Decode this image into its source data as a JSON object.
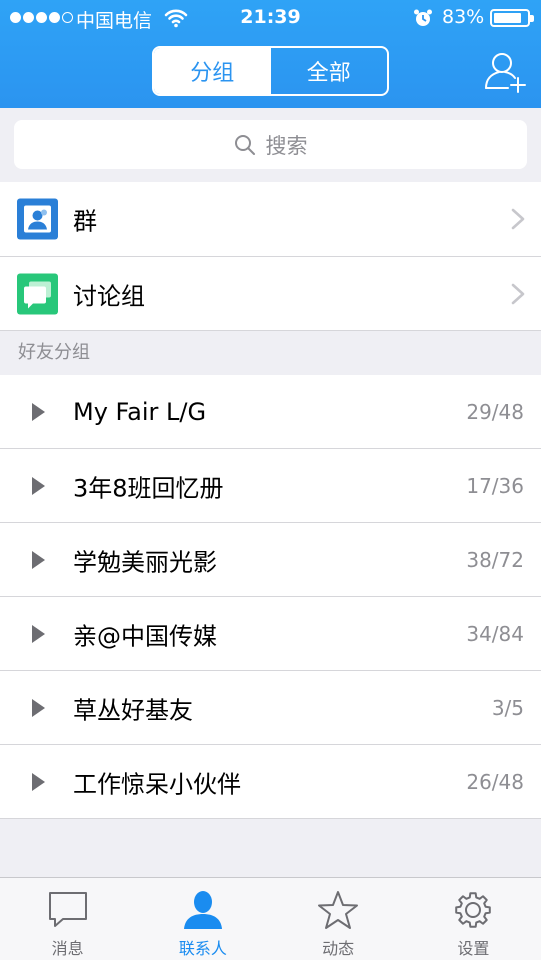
{
  "status_bar": {
    "carrier": "中国电信",
    "time": "21:39",
    "battery": "83%",
    "battery_level": 0.83,
    "signal_bars": 4,
    "signal_total": 5
  },
  "header": {
    "segments": [
      {
        "label": "分组",
        "active": true
      },
      {
        "label": "全部",
        "active": false
      }
    ],
    "add_friend_icon": "add-contact-icon"
  },
  "search": {
    "placeholder": "搜索"
  },
  "quick_entries": [
    {
      "label": "群",
      "icon": "group-icon",
      "color": "#2a7fd7"
    },
    {
      "label": "讨论组",
      "icon": "discussion-icon",
      "color": "#28c77a"
    }
  ],
  "section": {
    "title": "好友分组"
  },
  "friend_groups": [
    {
      "name": "My Fair L/G",
      "count": "29/48"
    },
    {
      "name": "3年8班回忆册",
      "count": "17/36"
    },
    {
      "name": "学勉美丽光影",
      "count": "38/72"
    },
    {
      "name": "亲@中国传媒",
      "count": "34/84"
    },
    {
      "name": "草丛好基友",
      "count": "3/5"
    },
    {
      "name": "工作惊呆小伙伴",
      "count": "26/48"
    }
  ],
  "tabbar": {
    "tabs": [
      {
        "label": "消息",
        "icon": "message-bubble-icon",
        "active": false
      },
      {
        "label": "联系人",
        "icon": "contact-person-icon",
        "active": true
      },
      {
        "label": "动态",
        "icon": "star-icon",
        "active": false
      },
      {
        "label": "设置",
        "icon": "gear-icon",
        "active": false
      }
    ]
  },
  "colors": {
    "accent": "#2b94f0",
    "background": "#efeff4",
    "secondary_text": "#8e8e93"
  }
}
